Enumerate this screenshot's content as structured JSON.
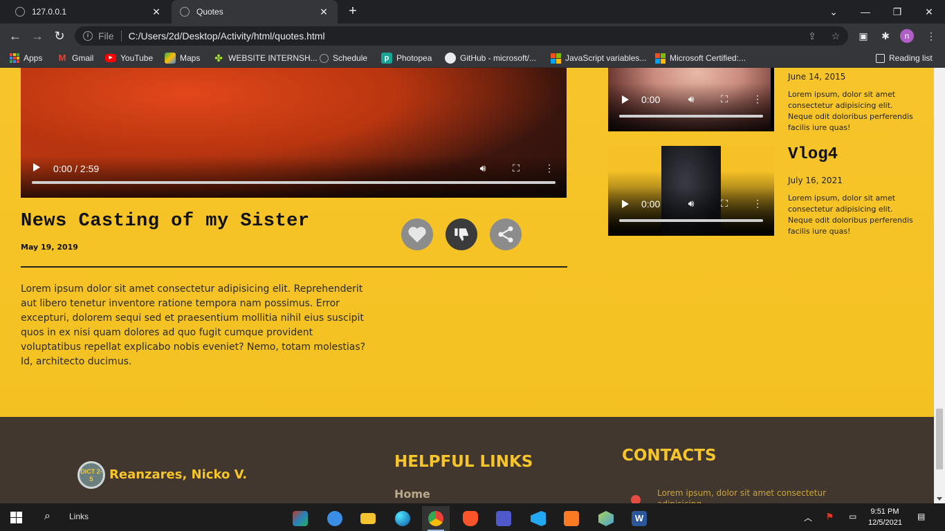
{
  "browser": {
    "tabs": [
      {
        "title": "127.0.0.1",
        "active": false
      },
      {
        "title": "Quotes",
        "active": true
      }
    ],
    "address": {
      "scheme": "File",
      "url": "C:/Users/2d/Desktop/Activity/html/quotes.html"
    },
    "bookmarks": [
      {
        "label": "Apps"
      },
      {
        "label": "Gmail"
      },
      {
        "label": "YouTube"
      },
      {
        "label": "Maps"
      },
      {
        "label": "WEBSITE INTERNSH..."
      },
      {
        "label": "Schedule"
      },
      {
        "label": "Photopea"
      },
      {
        "label": "GitHub - microsoft/..."
      },
      {
        "label": "JavaScript variables..."
      },
      {
        "label": "Microsoft Certified:..."
      }
    ],
    "reading_list": "Reading list",
    "profile_initial": "n"
  },
  "main_post": {
    "video": {
      "time": "0:00 / 2:59"
    },
    "title": "News Casting of my Sister",
    "date": "May 19, 2019",
    "body": "Lorem ipsum dolor sit amet consectetur adipisicing elit. Reprehenderit aut libero tenetur inventore ratione tempora nam possimus. Error excepturi, dolorem sequi sed et praesentium mollitia nihil eius suscipit quos in ex nisi quam dolores ad quo fugit cumque provident voluptatibus repellat explicabo nobis eveniet? Nemo, totam molestias? Id, architecto ducimus.",
    "actions": {
      "like": "heart-icon",
      "dislike": "thumbs-down-icon",
      "share": "share-icon"
    }
  },
  "sidebar": {
    "vlogs": [
      {
        "title": "",
        "date": "June 14, 2015",
        "text": "Lorem ipsum, dolor sit amet consectetur adipisicing elit. Neque odit doloribus perferendis facilis iure quas!",
        "video_time": "0:00"
      },
      {
        "title": "Vlog4",
        "date": "July 16, 2021",
        "text": "Lorem ipsum, dolor sit amet consectetur adipisicing elit. Neque odit doloribus perferendis facilis iure quas!",
        "video_time": "0:00"
      }
    ]
  },
  "footer": {
    "logo_text": "DICT 2-5",
    "name": "Reanzares, Nicko V.",
    "helpful_links_heading": "HELPFUL LINKS",
    "first_link": "Home",
    "contacts_heading": "CONTACTS",
    "contact_text": "Lorem ipsum, dolor sit amet consectetur adipisicing"
  },
  "taskbar": {
    "search_label": "Links",
    "time": "9:51 PM",
    "date": "12/5/2021"
  },
  "colors": {
    "page_bg": "#f7c52a",
    "footer_bg": "#41372e",
    "footer_accent": "#f7c52a"
  }
}
